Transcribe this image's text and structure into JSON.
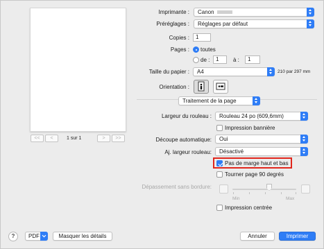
{
  "preview": {
    "page_count": "1 sur 1",
    "nav": [
      "<<",
      "<",
      ">",
      ">>"
    ]
  },
  "printer": {
    "label": "Imprimante :",
    "value": "Canon"
  },
  "presets": {
    "label": "Préréglages :",
    "value": "Réglages par défaut"
  },
  "copies": {
    "label": "Copies :",
    "value": "1"
  },
  "pages": {
    "label": "Pages :",
    "all_label": "toutes",
    "from_label": "de :",
    "from_value": "1",
    "to_label": "à :",
    "to_value": "1",
    "selected": "toutes"
  },
  "paper_size": {
    "label": "Taille du papier :",
    "value": "A4",
    "dimensions": "210 par 297 mm"
  },
  "orientation": {
    "label": "Orientation :",
    "selected": "portrait"
  },
  "section": {
    "value": "Traitement de la page"
  },
  "roll_width": {
    "label": "Largeur du rouleau :",
    "value": "Rouleau 24 po (609,6mm)"
  },
  "banner": {
    "label": "Impression bannière",
    "checked": false
  },
  "auto_cut": {
    "label": "Découpe automatique:",
    "value": "Oui"
  },
  "adj_roll": {
    "label": "Aj. largeur rouleau:",
    "value": "Désactivé"
  },
  "no_margin": {
    "label": "Pas de marge haut et bas",
    "checked": true
  },
  "rotate": {
    "label": "Tourner page 90 degrés",
    "checked": false
  },
  "overflow": {
    "label": "Dépassement sans bordure:",
    "min": "Min",
    "max": "Max"
  },
  "centered": {
    "label": "Impression centrée",
    "checked": false
  },
  "footer": {
    "help": "?",
    "pdf": "PDF",
    "hide_details": "Masquer les détails",
    "cancel": "Annuler",
    "print": "Imprimer"
  },
  "colors": {
    "accent": "#2f7df6",
    "highlight": "#e1261c"
  },
  "icons": [
    "help-icon",
    "chevron-down-icon",
    "portrait-icon",
    "landscape-icon",
    "checkmark-icon",
    "radio-icon"
  ]
}
